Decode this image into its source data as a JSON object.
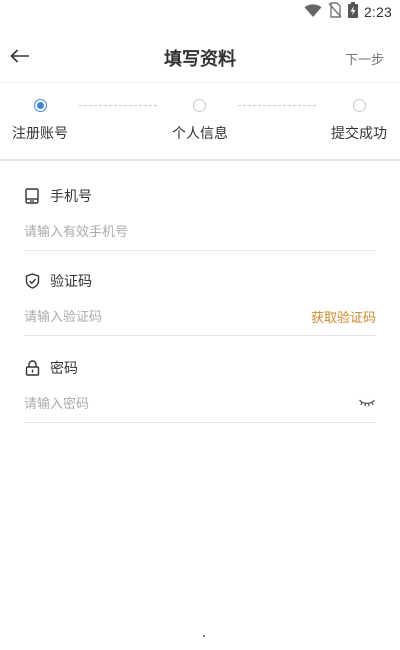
{
  "status_bar": {
    "time": "2:23",
    "icons": [
      "wifi-icon",
      "no-sim-icon",
      "battery-charging-icon"
    ]
  },
  "header": {
    "title": "填写资料",
    "next_label": "下一步",
    "back_icon": "arrow-left-icon"
  },
  "steps": [
    {
      "label": "注册账号",
      "active": true
    },
    {
      "label": "个人信息",
      "active": false
    },
    {
      "label": "提交成功",
      "active": false
    }
  ],
  "form": {
    "phone": {
      "label": "手机号",
      "placeholder": "请输入有效手机号",
      "value": "",
      "icon": "phone-icon"
    },
    "code": {
      "label": "验证码",
      "placeholder": "请输入验证码",
      "value": "",
      "icon": "shield-check-icon",
      "action_label": "获取验证码"
    },
    "password": {
      "label": "密码",
      "placeholder": "请输入密码",
      "value": "",
      "icon": "lock-icon",
      "toggle_icon": "eye-closed-icon"
    }
  },
  "colors": {
    "accent_blue": "#3e86d6",
    "action_orange": "#c9892a",
    "placeholder_gray": "#aaaaaa"
  }
}
